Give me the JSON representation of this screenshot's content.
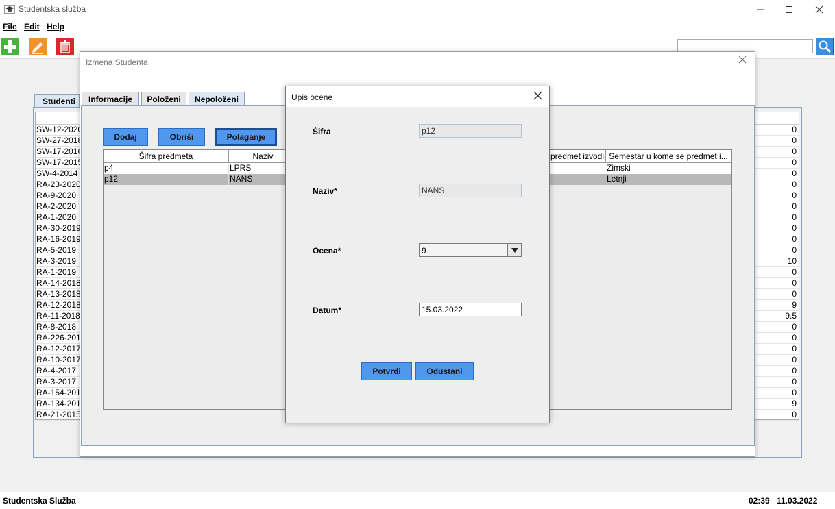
{
  "window": {
    "title": "Studentska služba"
  },
  "menu": {
    "file": "File",
    "edit": "Edit",
    "help": "Help"
  },
  "search": {
    "value": ""
  },
  "background": {
    "tab_label": "Studenti",
    "left_column": [
      "SW-12-2020",
      "SW-27-2018",
      "SW-17-2016",
      "SW-17-2015",
      "SW-4-2014",
      "RA-23-2020",
      "RA-9-2020",
      "RA-2-2020",
      "RA-1-2020",
      "RA-30-2019",
      "RA-16-2019",
      "RA-5-2019",
      "RA-3-2019",
      "RA-1-2019",
      "RA-14-2018",
      "RA-13-2018",
      "RA-12-2018",
      "RA-11-2018",
      "RA-8-2018",
      "RA-226-201",
      "RA-12-2017",
      "RA-10-2017",
      "RA-4-2017",
      "RA-3-2017",
      "RA-154-201",
      "RA-134-201",
      "RA-21-2015"
    ],
    "right_column": [
      "0",
      "0",
      "0",
      "0",
      "0",
      "0",
      "0",
      "0",
      "0",
      "0",
      "0",
      "0",
      "10",
      "0",
      "0",
      "0",
      "9",
      "9.5",
      "0",
      "0",
      "0",
      "0",
      "0",
      "0",
      "0",
      "9",
      "0"
    ]
  },
  "status": {
    "app_name": "Studentska Služba",
    "time": "02:39",
    "date": "11.03.2022"
  },
  "edit_dialog": {
    "title": "Izmena Studenta",
    "tabs": [
      "Informacije",
      "Položeni",
      "Nepoloženi"
    ],
    "buttons": {
      "add": "Dodaj",
      "delete": "Obriši",
      "exam": "Polaganje"
    },
    "table": {
      "headers": [
        "Šifra predmeta",
        "Naziv",
        "predmet izvodi",
        "Semestar u kome se predmet i..."
      ],
      "rows": [
        {
          "code": "p4",
          "name": "LPRS",
          "semester": "Zimski"
        },
        {
          "code": "p12",
          "name": "NANS",
          "semester": "Letnji"
        }
      ]
    }
  },
  "grade_dialog": {
    "title": "Upis ocene",
    "code_label": "Šifra",
    "code_value": "p12",
    "name_label": "Naziv*",
    "name_value": "NANS",
    "grade_label": "Ocena*",
    "grade_value": "9",
    "date_label": "Datum*",
    "date_value": "15.03.2022",
    "confirm": "Potvrdi",
    "cancel": "Odustani"
  },
  "colors": {
    "accent_button": "#4f97ef",
    "selected_row": "#b8b8b8",
    "add_icon": "#49b43c",
    "edit_icon": "#f0932e",
    "delete_icon": "#d42b2b",
    "search_button": "#3a8ee0"
  },
  "icons": {
    "app": "student-cap-icon",
    "add": "plus-icon",
    "edit": "pencil-icon",
    "delete": "trash-icon",
    "search": "magnifier-icon",
    "dropdown": "triangle-down-icon"
  }
}
